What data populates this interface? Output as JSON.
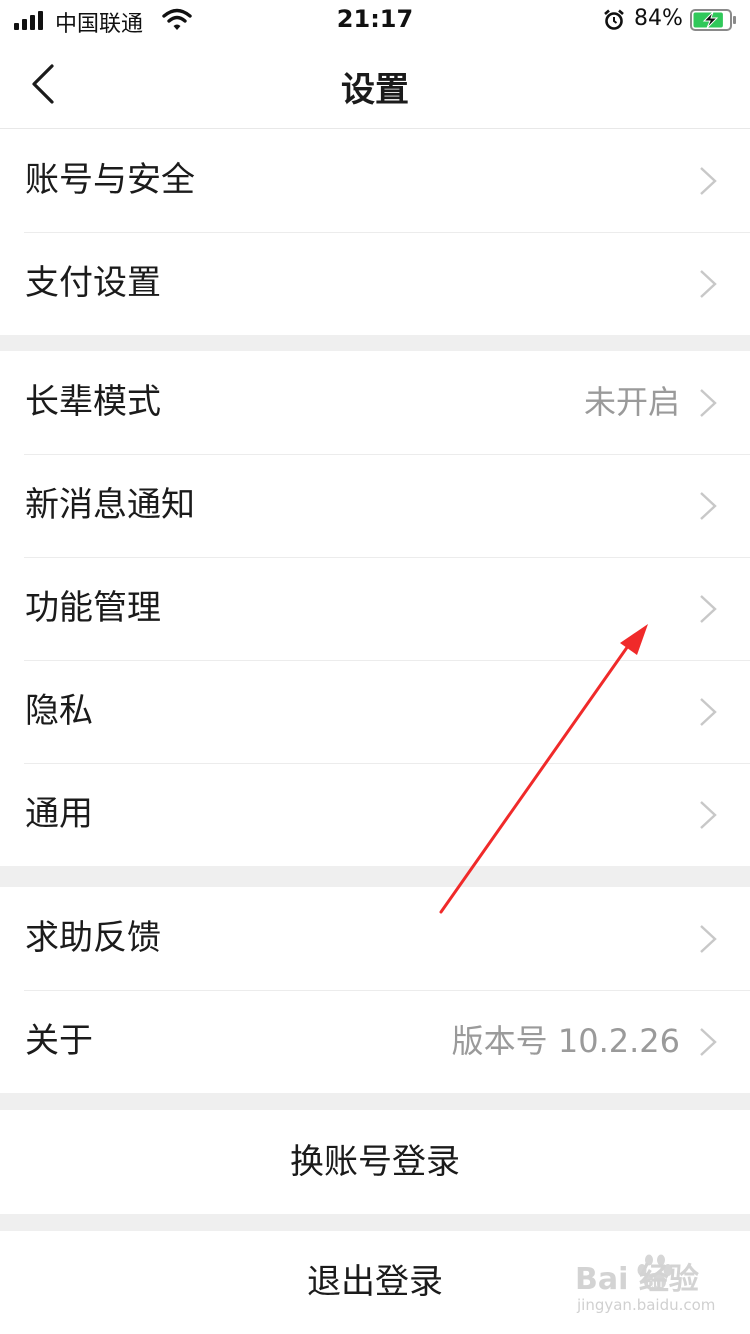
{
  "status_bar": {
    "carrier": "中国联通",
    "time": "21:17",
    "battery_percent": "84%",
    "battery_level": 0.84
  },
  "nav": {
    "title": "设置",
    "back_icon": "chevron-left-icon"
  },
  "groups": [
    {
      "items": [
        {
          "label": "账号与安全",
          "value": ""
        },
        {
          "label": "支付设置",
          "value": ""
        }
      ]
    },
    {
      "items": [
        {
          "label": "长辈模式",
          "value": "未开启"
        },
        {
          "label": "新消息通知",
          "value": ""
        },
        {
          "label": "功能管理",
          "value": ""
        },
        {
          "label": "隐私",
          "value": ""
        },
        {
          "label": "通用",
          "value": ""
        }
      ]
    },
    {
      "items": [
        {
          "label": "求助反馈",
          "value": ""
        },
        {
          "label": "关于",
          "value": "版本号 10.2.26"
        }
      ]
    }
  ],
  "actions": {
    "switch_account": "换账号登录",
    "logout": "退出登录"
  },
  "annotation": {
    "color": "#f02a2a"
  },
  "watermark": {
    "text": "Bai 经验",
    "url_text": "jingyan.baidu.com"
  }
}
